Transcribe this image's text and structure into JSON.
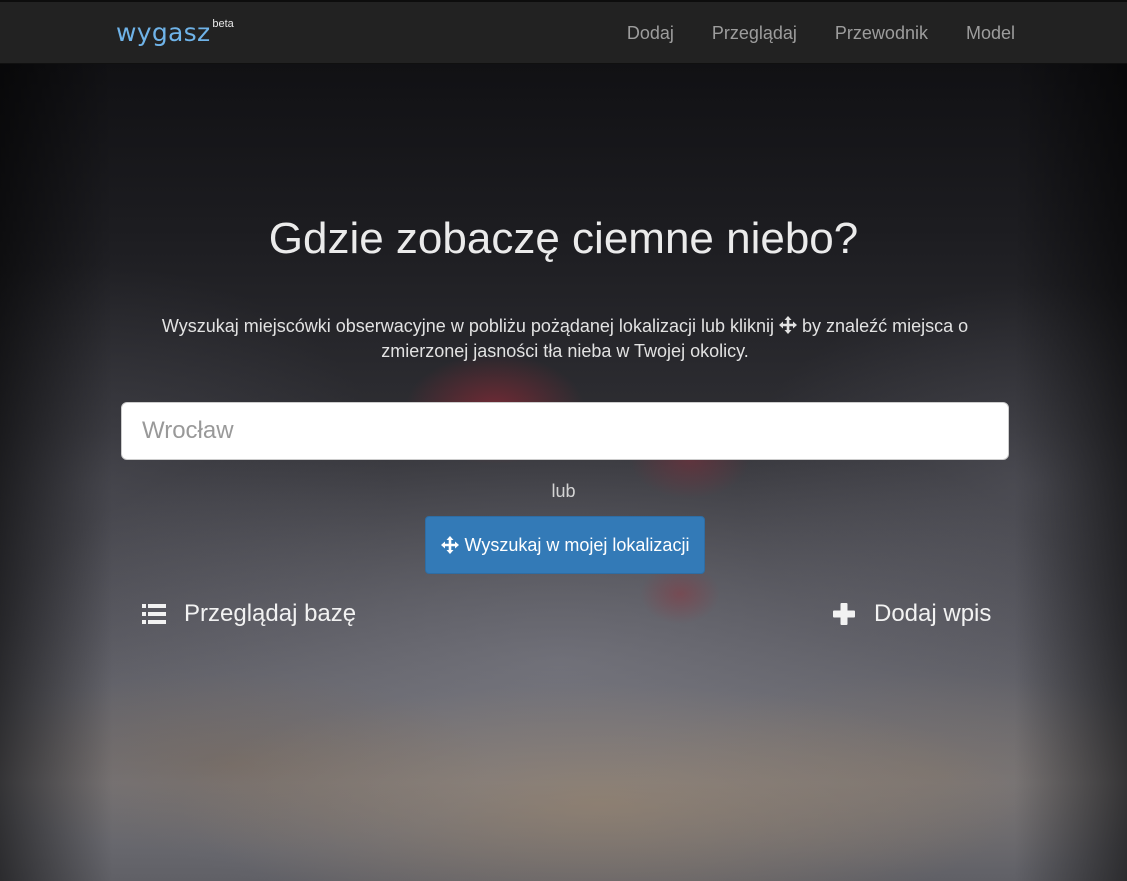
{
  "brand": {
    "name": "wygasz",
    "superscript": "beta",
    "color": "#6fb3e8"
  },
  "nav": {
    "items": [
      {
        "label": "Dodaj"
      },
      {
        "label": "Przeglądaj"
      },
      {
        "label": "Przewodnik"
      },
      {
        "label": "Model"
      }
    ]
  },
  "hero": {
    "title": "Gdzie zobaczę ciemne niebo?",
    "subtitle_before_icon": "Wyszukaj miejscówki obserwacyjne w pobliżu pożądanej lokalizacji lub kliknij",
    "subtitle_after_icon": "by znaleźć miejsca o zmierzonej jasności tła nieba w Twojej okolicy.",
    "subtitle_icon": "crosshair-icon"
  },
  "search": {
    "value": "",
    "placeholder": "Wrocław"
  },
  "or_label": "lub",
  "locate_button": {
    "label": "Wyszukaj w mojej lokalizacji",
    "icon": "crosshair-icon",
    "color": "#337ab7"
  },
  "links": {
    "browse": {
      "label": "Przeglądaj bazę",
      "icon": "list-icon"
    },
    "add": {
      "label": "Dodaj wpis",
      "icon": "plus-icon"
    }
  }
}
